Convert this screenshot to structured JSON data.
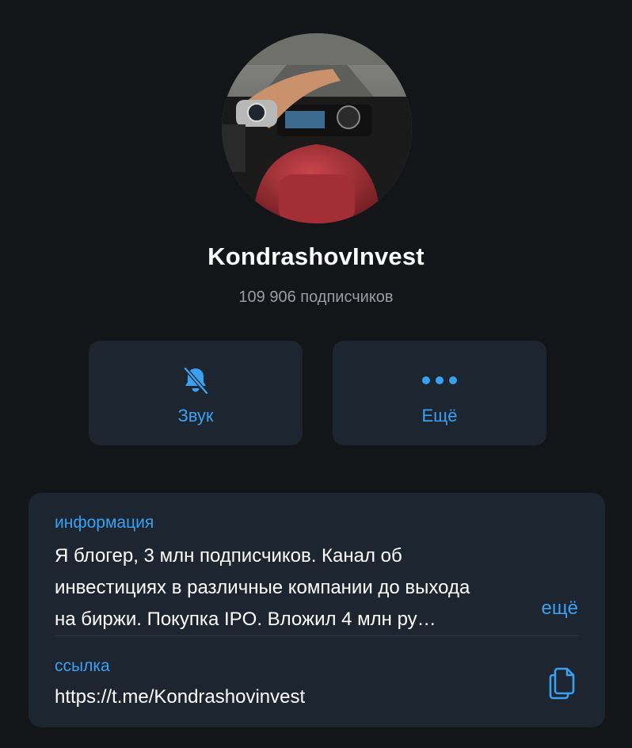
{
  "channel": {
    "name": "KondrashovInvest",
    "subscribers": "109 906 подписчиков"
  },
  "actions": {
    "sound_label": "Звук",
    "sound_icon": "bell-muted-icon",
    "more_label": "Ещё",
    "more_icon": "more-dots-icon"
  },
  "info": {
    "label": "информация",
    "lines": [
      "Я блогер, 3 млн подписчиков. Канал об",
      "инвестициях в различные компании до выхода",
      "на биржи. Покупка IPO. Вложил 4 млн ру…"
    ],
    "more": "ещё"
  },
  "link": {
    "label": "ссылка",
    "value": "https://t.me/Kondrashovinvest",
    "copy_icon": "copy-icon"
  },
  "colors": {
    "background": "#141518",
    "card": "#1c2530",
    "accent": "#3aa1f2",
    "secondary_text": "#9a9ea4"
  }
}
